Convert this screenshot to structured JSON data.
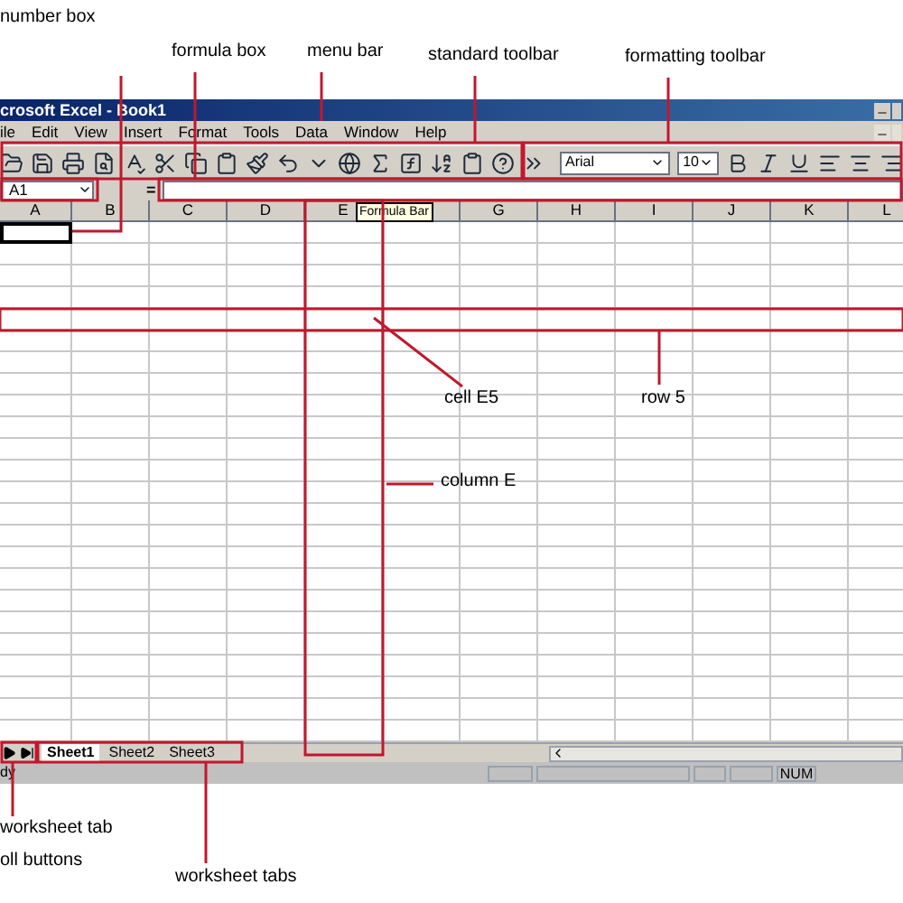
{
  "annotations": [
    {
      "text": "number box"
    },
    {
      "text": "formula box"
    },
    {
      "text": "menu bar"
    },
    {
      "text": "standard toolbar"
    },
    {
      "text": "formatting toolbar"
    },
    {
      "text": "cell E5"
    },
    {
      "text": "row 5"
    },
    {
      "text": "column E"
    },
    {
      "text": "worksheet tab"
    },
    {
      "text": "oll buttons"
    },
    {
      "text": "worksheet tabs"
    }
  ],
  "window": {
    "title": "crosoft Excel - Book1"
  },
  "menu": [
    "ile",
    "Edit",
    "View",
    "Insert",
    "Format",
    "Tools",
    "Data",
    "Window",
    "Help"
  ],
  "formatting": {
    "font": "Arial",
    "size": "10"
  },
  "formula_bar": {
    "name_box": "A1",
    "equals": "=",
    "tooltip": "Formula Bar"
  },
  "columns": [
    "A",
    "B",
    "C",
    "D",
    "E",
    "G",
    "H",
    "I",
    "J",
    "K",
    "L"
  ],
  "sheet_tabs": [
    {
      "label": "Sheet1",
      "selected": true
    },
    {
      "label": "Sheet2",
      "selected": false
    },
    {
      "label": "Sheet3",
      "selected": false
    }
  ],
  "status_bar": {
    "state": "dy",
    "num": "NUM"
  }
}
